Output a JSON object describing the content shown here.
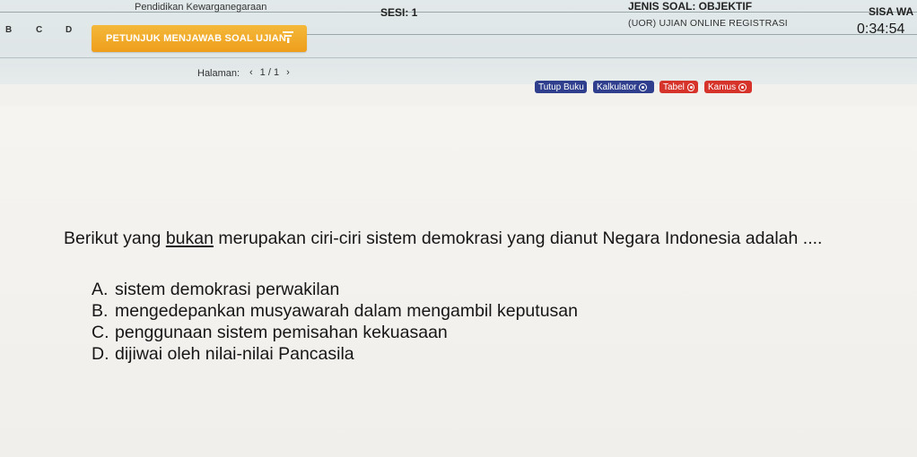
{
  "header": {
    "subject": "Pendidikan Kewarganegaraan",
    "session": "SESI: 1",
    "question_type": "JENIS SOAL: OBJEKTIF",
    "exam_name": "(UOR) UJIAN ONLINE REGISTRASI",
    "time_left_label": "SISA WA",
    "time_left_value": "0:34:54"
  },
  "nav_letters": [
    "B",
    "C",
    "D"
  ],
  "instruction_button": "PETUNJUK MENJAWAB SOAL UJIAN",
  "pagination": {
    "label": "Halaman:",
    "prev": "‹",
    "current": "1 / 1",
    "next": "›"
  },
  "tools": {
    "tutup_buku": "Tutup Buku",
    "kalkulator": "Kalkulator",
    "tabel": "Tabel",
    "kamus": "Kamus"
  },
  "question": {
    "before": "Berikut yang ",
    "underlined": "bukan",
    "after": " merupakan ciri-ciri sistem demokrasi yang dianut Negara Indonesia adalah ...."
  },
  "options": [
    {
      "letter": "A.",
      "text": "sistem demokrasi perwakilan"
    },
    {
      "letter": "B.",
      "text": "mengedepankan musyawarah dalam mengambil keputusan"
    },
    {
      "letter": "C.",
      "text": "penggunaan sistem pemisahan kekuasaan"
    },
    {
      "letter": "D.",
      "text": "dijiwai oleh nilai-nilai Pancasila"
    }
  ],
  "colors": {
    "instruction_button": "#ee9e1b",
    "tool_blue": "#2f3f8e",
    "tool_red": "#d6342b"
  }
}
